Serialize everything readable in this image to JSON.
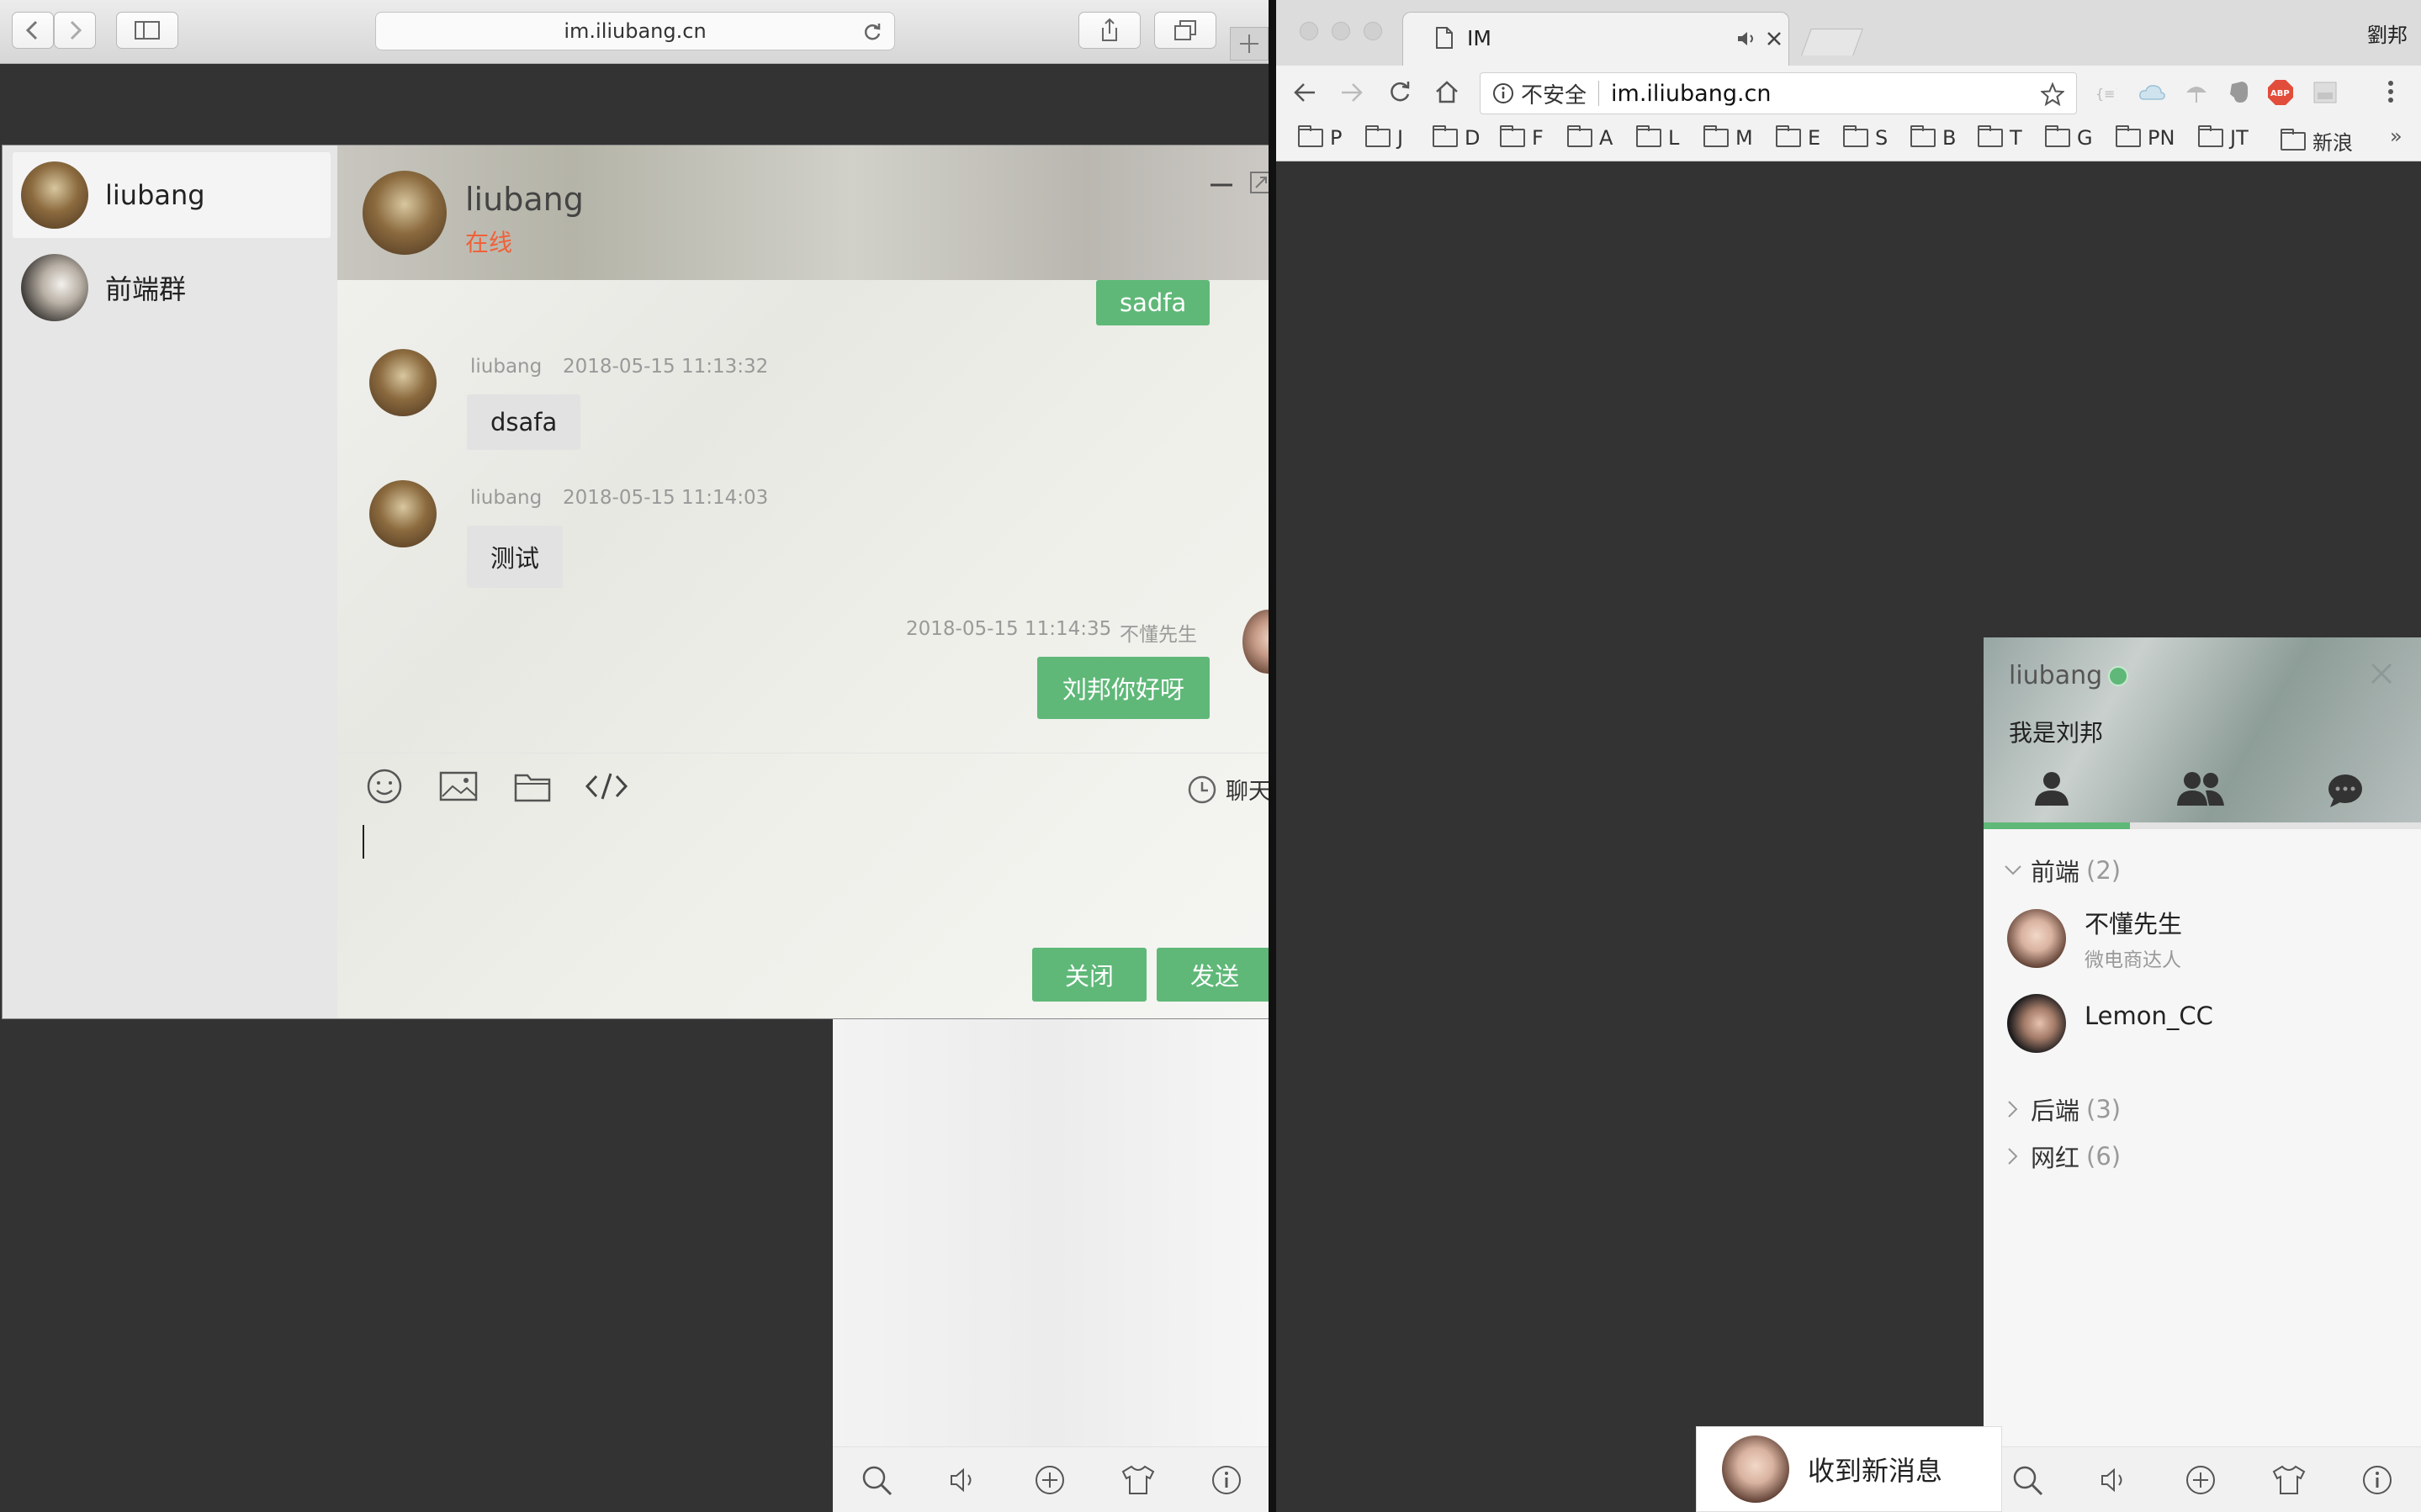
{
  "safari": {
    "url": "im.iliubang.cn"
  },
  "chat": {
    "list": [
      {
        "name": "liubang"
      },
      {
        "name": "前端群"
      }
    ],
    "header": {
      "name": "liubang",
      "status": "在线"
    },
    "messages": {
      "top_partial": "sadfa",
      "m1": {
        "user": "liubang",
        "time": "2018-05-15 11:13:32",
        "text": "dsafa"
      },
      "m2": {
        "user": "liubang",
        "time": "2018-05-15 11:14:03",
        "text": "测试"
      },
      "m3": {
        "user": "不懂先生",
        "time": "2018-05-15 11:14:35",
        "text": "刘邦你好呀"
      }
    },
    "toolbar": {
      "history_label": "聊天"
    },
    "buttons": {
      "close": "关闭",
      "send": "发送"
    }
  },
  "chrome": {
    "tab_title": "IM",
    "profile_name": "劉邦",
    "insecure_label": "不安全",
    "url": "im.iliubang.cn",
    "bookmarks": [
      "P",
      "J",
      "D",
      "F",
      "A",
      "L",
      "M",
      "E",
      "S",
      "B",
      "T",
      "G",
      "PN",
      "JT",
      "新浪"
    ],
    "more": "»"
  },
  "im_panel": {
    "username": "liubang",
    "signature": "我是刘邦",
    "groups": [
      {
        "name": "前端",
        "count": "(2)",
        "expanded": true,
        "friends": [
          {
            "name": "不懂先生",
            "sign": "微电商达人"
          },
          {
            "name": "Lemon_CC",
            "sign": ""
          }
        ]
      },
      {
        "name": "后端",
        "count": "(3)",
        "expanded": false
      },
      {
        "name": "网红",
        "count": "(6)",
        "expanded": false
      }
    ],
    "online_color": "#5fb878"
  },
  "toast": {
    "text": "收到新消息"
  },
  "colors": {
    "accent": "#5fb878",
    "status_online": "#f0613a",
    "desktop": "#333333"
  }
}
